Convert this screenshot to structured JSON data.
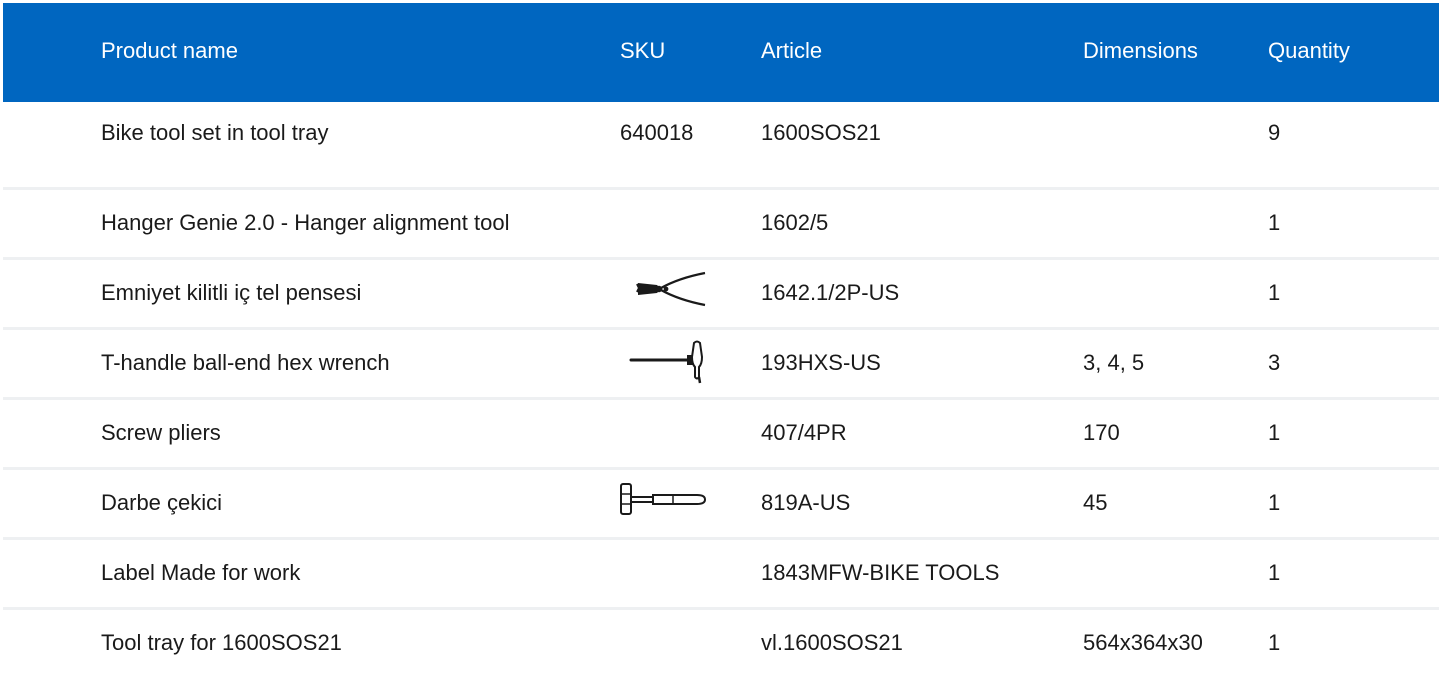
{
  "table": {
    "headers": {
      "name": "Product name",
      "sku": "SKU",
      "article": "Article",
      "dimensions": "Dimensions",
      "quantity": "Quantity"
    },
    "rows": [
      {
        "name": "Bike tool set in tool tray",
        "sku": "640018",
        "article": "1600SOS21",
        "dimensions": "",
        "quantity": "9",
        "icon": ""
      },
      {
        "name": "Hanger Genie 2.0 - Hanger alignment tool",
        "sku": "",
        "article": "1602/5",
        "dimensions": "",
        "quantity": "1",
        "icon": ""
      },
      {
        "name": "Emniyet kilitli iç tel pensesi",
        "sku": "",
        "article": "1642.1/2P-US",
        "dimensions": "",
        "quantity": "1",
        "icon": "circlip-pliers-icon"
      },
      {
        "name": "T-handle ball-end hex wrench",
        "sku": "",
        "article": "193HXS-US",
        "dimensions": "3, 4, 5",
        "quantity": "3",
        "icon": "t-handle-wrench-icon"
      },
      {
        "name": "Screw pliers",
        "sku": "",
        "article": "407/4PR",
        "dimensions": "170",
        "quantity": "1",
        "icon": ""
      },
      {
        "name": "Darbe çekici",
        "sku": "",
        "article": "819A-US",
        "dimensions": "45",
        "quantity": "1",
        "icon": "hammer-icon"
      },
      {
        "name": "Label Made for work",
        "sku": "",
        "article": "1843MFW-BIKE TOOLS",
        "dimensions": "",
        "quantity": "1",
        "icon": ""
      },
      {
        "name": "Tool tray for 1600SOS21",
        "sku": "",
        "article": "vl.1600SOS21",
        "dimensions": "564x364x30",
        "quantity": "1",
        "icon": ""
      }
    ]
  },
  "colors": {
    "header_background": "#0066c0",
    "header_text": "#ffffff",
    "row_divider": "#eef0f2",
    "text": "#1a1a1a"
  }
}
